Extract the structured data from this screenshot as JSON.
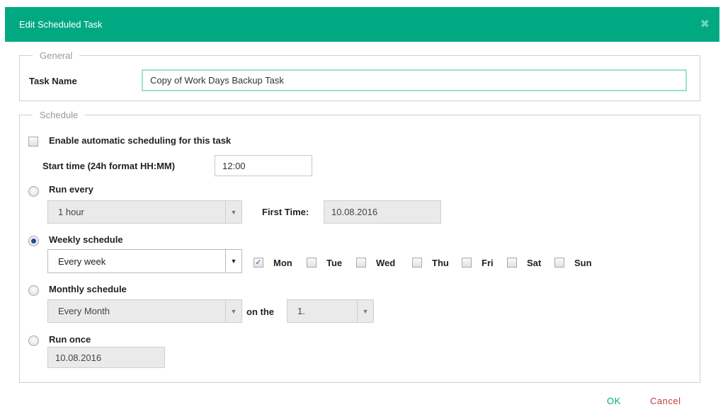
{
  "dialog": {
    "title": "Edit Scheduled Task",
    "close_icon": "close-icon"
  },
  "general": {
    "legend": "General",
    "task_name_label": "Task Name",
    "task_name_value": "Copy of Work Days Backup Task"
  },
  "schedule": {
    "legend": "Schedule",
    "enable_label": "Enable automatic scheduling for this task",
    "enable_checked": false,
    "start_time_label": "Start time (24h format HH:MM)",
    "start_time_value": "12:00",
    "run_every": {
      "label": "Run every",
      "selected": false,
      "interval": "1 hour",
      "first_time_label": "First Time:",
      "first_time_value": "10.08.2016"
    },
    "weekly": {
      "label": "Weekly schedule",
      "selected": true,
      "frequency": "Every week",
      "days": [
        {
          "label": "Mon",
          "checked": true
        },
        {
          "label": "Tue",
          "checked": false
        },
        {
          "label": "Wed",
          "checked": false
        },
        {
          "label": "Thu",
          "checked": false
        },
        {
          "label": "Fri",
          "checked": false
        },
        {
          "label": "Sat",
          "checked": false
        },
        {
          "label": "Sun",
          "checked": false
        }
      ]
    },
    "monthly": {
      "label": "Monthly schedule",
      "selected": false,
      "frequency": "Every Month",
      "on_the_label": "on the",
      "day_value": "1."
    },
    "once": {
      "label": "Run once",
      "selected": false,
      "date_value": "10.08.2016"
    }
  },
  "footer": {
    "ok_label": "OK",
    "cancel_label": "Cancel"
  },
  "colors": {
    "accent": "#01a982",
    "cancel": "#c43c3c"
  }
}
